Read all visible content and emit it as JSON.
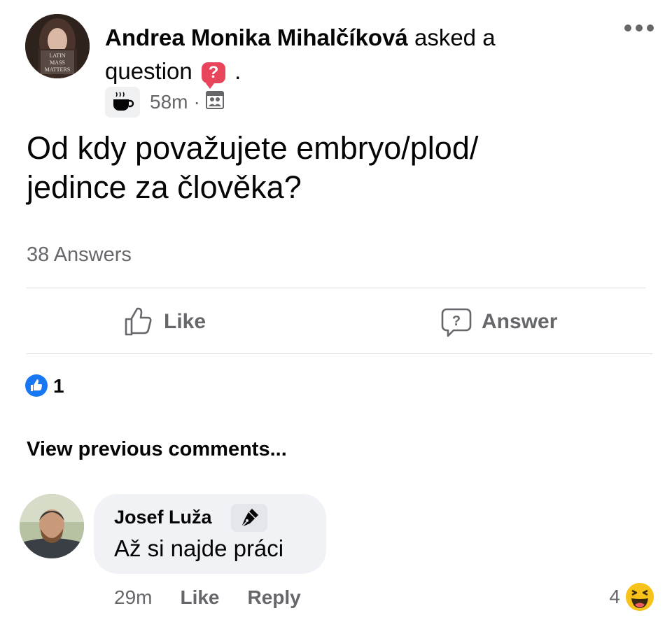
{
  "post": {
    "author_name": "Andrea Monika Mihalčíková",
    "action_text_1": "asked a",
    "action_text_2": "question",
    "action_suffix": ".",
    "question_badge": "?",
    "avatar_text_1": "LATIN",
    "avatar_text_2": "MASS",
    "avatar_text_3": "MATTERS",
    "time": "58m",
    "time_separator": "·",
    "question_line_1": "Od kdy považujete embryo/plod/",
    "question_line_2": "jedince za člověka?",
    "answers_count": "38 Answers"
  },
  "actions": {
    "like_label": "Like",
    "answer_label": "Answer"
  },
  "reactions": {
    "like_count": "1"
  },
  "comments_section": {
    "view_previous": "View previous comments..."
  },
  "comment": {
    "author": "Josef Luža",
    "text": "Až si najde práci",
    "time": "29m",
    "like_label": "Like",
    "reply_label": "Reply",
    "reaction_count": "4"
  },
  "colors": {
    "accent_blue": "#1877f2",
    "question_badge": "#e8445a",
    "secondary_text": "#65676b",
    "bubble_bg": "#f0f2f5"
  },
  "icons": [
    "more-options-icon",
    "question-badge-icon",
    "coffee-cup-icon",
    "audience-group-icon",
    "thumbs-up-icon",
    "answer-question-icon",
    "like-reaction-icon",
    "pen-nib-icon",
    "haha-reaction-icon"
  ]
}
